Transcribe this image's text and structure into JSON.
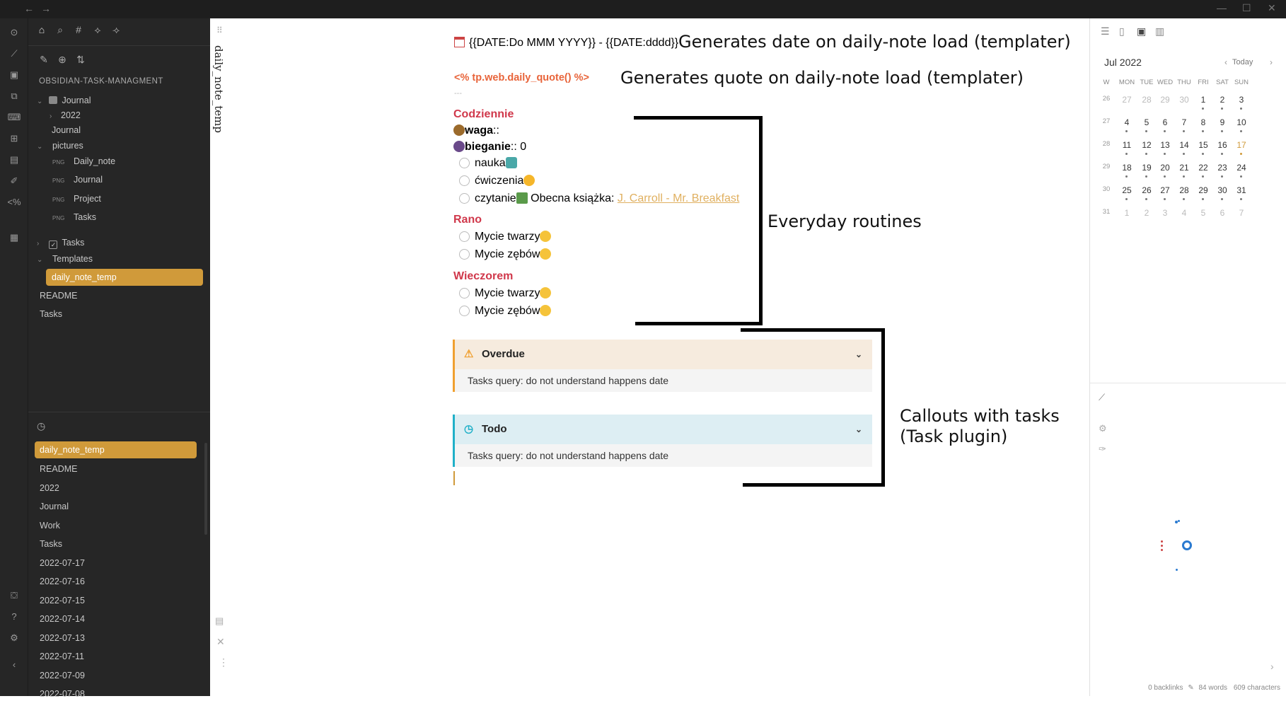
{
  "titlebar": {
    "back_icon": "←",
    "forward_icon": "→",
    "min_icon": "—",
    "max_icon": "☐",
    "close_icon": "✕"
  },
  "sidebar": {
    "vault_name": "OBSIDIAN-TASK-MANAGMENT",
    "tree": [
      {
        "label": "Journal",
        "chev": "⌄"
      },
      {
        "label": "2022",
        "chev": "›"
      },
      {
        "label": "Journal",
        "chev": ""
      },
      {
        "label": "pictures",
        "chev": "⌄"
      },
      {
        "label": "Daily_note",
        "badge": "PNG"
      },
      {
        "label": "Journal",
        "badge": "PNG"
      },
      {
        "label": "Project",
        "badge": "PNG"
      },
      {
        "label": "Tasks",
        "badge": "PNG"
      },
      {
        "label": "Tasks",
        "chev": "›"
      },
      {
        "label": "Templates",
        "chev": "⌄"
      },
      {
        "label": "daily_note_temp",
        "active": true
      },
      {
        "label": "README"
      },
      {
        "label": "Tasks"
      }
    ],
    "recent": [
      "daily_note_temp",
      "README",
      "2022",
      "Journal",
      "Work",
      "Tasks",
      "2022-07-17",
      "2022-07-16",
      "2022-07-15",
      "2022-07-14",
      "2022-07-13",
      "2022-07-11",
      "2022-07-09",
      "2022-07-08"
    ]
  },
  "note": {
    "vertical_title": "daily_note_temp",
    "date_line": "{{DATE:Do MMM YYYY}} - {{DATE:dddd}}",
    "quote_line": "<% tp.web.daily_quote() %>",
    "hr": "---",
    "h_daily": "Codziennie",
    "waga_label": "waga",
    "waga_suffix": "::",
    "bieganie_label": "bieganie",
    "bieganie_suffix": ":: 0",
    "task_nauka": "nauka",
    "task_cwiczenia": "ćwiczenia",
    "task_czytanie": "czytanie",
    "czytanie_extra": " Obecna książka: ",
    "book_link": "J. Carroll - Mr. Breakfast",
    "h_morning": "Rano",
    "task_mycie_twarzy": "Mycie twarzy",
    "task_mycie_zebow": "Mycie zębów",
    "h_evening": "Wieczorem",
    "task_mycie_twarzy_2": "Mycie twarzy",
    "task_mycie_zebow_2": "Mycie zębów"
  },
  "callouts": {
    "overdue_title": "Overdue",
    "overdue_body": "Tasks query: do not understand happens date",
    "todo_title": "Todo",
    "todo_body": "Tasks query: do not understand happens date"
  },
  "annotations": {
    "date": "Generates date on daily-note load (templater)",
    "quote": "Generates quote on daily-note load (templater)",
    "routines": "Everyday routines",
    "callouts_line1": "Callouts with tasks",
    "callouts_line2": "(Task plugin)"
  },
  "calendar": {
    "month": "Jul 2022",
    "today_label": "Today",
    "headers": [
      "W",
      "MON",
      "TUE",
      "WED",
      "THU",
      "FRI",
      "SAT",
      "SUN"
    ],
    "weeks": [
      [
        "26",
        "27",
        "28",
        "29",
        "30",
        "1",
        "2",
        "3"
      ],
      [
        "27",
        "4",
        "5",
        "6",
        "7",
        "8",
        "9",
        "10"
      ],
      [
        "28",
        "11",
        "12",
        "13",
        "14",
        "15",
        "16",
        "17"
      ],
      [
        "29",
        "18",
        "19",
        "20",
        "21",
        "22",
        "23",
        "24"
      ],
      [
        "30",
        "25",
        "26",
        "27",
        "28",
        "29",
        "30",
        "31"
      ],
      [
        "31",
        "1",
        "2",
        "3",
        "4",
        "5",
        "6",
        "7"
      ]
    ],
    "today_date": "17",
    "accent": "#d09a3a"
  },
  "status": {
    "backlinks": "0 backlinks",
    "words": "84 words",
    "chars": "609 characters"
  },
  "colors": {
    "accent": "#d09a3a",
    "heading": "#d0384b",
    "overdue_bar": "#f0a030",
    "todo_bar": "#20b0c8"
  }
}
